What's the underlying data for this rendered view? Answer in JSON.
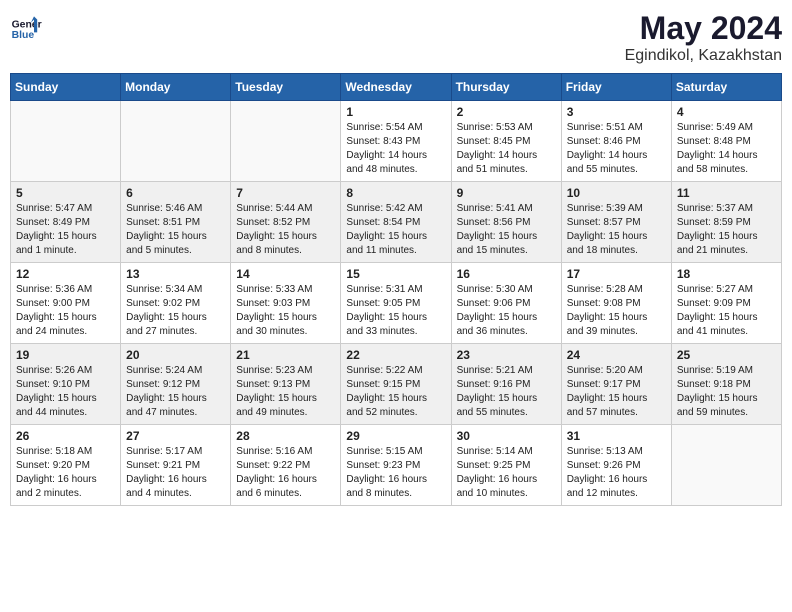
{
  "logo": {
    "line1": "General",
    "line2": "Blue"
  },
  "title": "May 2024",
  "location": "Egindikol, Kazakhstan",
  "days_of_week": [
    "Sunday",
    "Monday",
    "Tuesday",
    "Wednesday",
    "Thursday",
    "Friday",
    "Saturday"
  ],
  "weeks": [
    [
      {
        "day": "",
        "info": ""
      },
      {
        "day": "",
        "info": ""
      },
      {
        "day": "",
        "info": ""
      },
      {
        "day": "1",
        "info": "Sunrise: 5:54 AM\nSunset: 8:43 PM\nDaylight: 14 hours\nand 48 minutes."
      },
      {
        "day": "2",
        "info": "Sunrise: 5:53 AM\nSunset: 8:45 PM\nDaylight: 14 hours\nand 51 minutes."
      },
      {
        "day": "3",
        "info": "Sunrise: 5:51 AM\nSunset: 8:46 PM\nDaylight: 14 hours\nand 55 minutes."
      },
      {
        "day": "4",
        "info": "Sunrise: 5:49 AM\nSunset: 8:48 PM\nDaylight: 14 hours\nand 58 minutes."
      }
    ],
    [
      {
        "day": "5",
        "info": "Sunrise: 5:47 AM\nSunset: 8:49 PM\nDaylight: 15 hours\nand 1 minute."
      },
      {
        "day": "6",
        "info": "Sunrise: 5:46 AM\nSunset: 8:51 PM\nDaylight: 15 hours\nand 5 minutes."
      },
      {
        "day": "7",
        "info": "Sunrise: 5:44 AM\nSunset: 8:52 PM\nDaylight: 15 hours\nand 8 minutes."
      },
      {
        "day": "8",
        "info": "Sunrise: 5:42 AM\nSunset: 8:54 PM\nDaylight: 15 hours\nand 11 minutes."
      },
      {
        "day": "9",
        "info": "Sunrise: 5:41 AM\nSunset: 8:56 PM\nDaylight: 15 hours\nand 15 minutes."
      },
      {
        "day": "10",
        "info": "Sunrise: 5:39 AM\nSunset: 8:57 PM\nDaylight: 15 hours\nand 18 minutes."
      },
      {
        "day": "11",
        "info": "Sunrise: 5:37 AM\nSunset: 8:59 PM\nDaylight: 15 hours\nand 21 minutes."
      }
    ],
    [
      {
        "day": "12",
        "info": "Sunrise: 5:36 AM\nSunset: 9:00 PM\nDaylight: 15 hours\nand 24 minutes."
      },
      {
        "day": "13",
        "info": "Sunrise: 5:34 AM\nSunset: 9:02 PM\nDaylight: 15 hours\nand 27 minutes."
      },
      {
        "day": "14",
        "info": "Sunrise: 5:33 AM\nSunset: 9:03 PM\nDaylight: 15 hours\nand 30 minutes."
      },
      {
        "day": "15",
        "info": "Sunrise: 5:31 AM\nSunset: 9:05 PM\nDaylight: 15 hours\nand 33 minutes."
      },
      {
        "day": "16",
        "info": "Sunrise: 5:30 AM\nSunset: 9:06 PM\nDaylight: 15 hours\nand 36 minutes."
      },
      {
        "day": "17",
        "info": "Sunrise: 5:28 AM\nSunset: 9:08 PM\nDaylight: 15 hours\nand 39 minutes."
      },
      {
        "day": "18",
        "info": "Sunrise: 5:27 AM\nSunset: 9:09 PM\nDaylight: 15 hours\nand 41 minutes."
      }
    ],
    [
      {
        "day": "19",
        "info": "Sunrise: 5:26 AM\nSunset: 9:10 PM\nDaylight: 15 hours\nand 44 minutes."
      },
      {
        "day": "20",
        "info": "Sunrise: 5:24 AM\nSunset: 9:12 PM\nDaylight: 15 hours\nand 47 minutes."
      },
      {
        "day": "21",
        "info": "Sunrise: 5:23 AM\nSunset: 9:13 PM\nDaylight: 15 hours\nand 49 minutes."
      },
      {
        "day": "22",
        "info": "Sunrise: 5:22 AM\nSunset: 9:15 PM\nDaylight: 15 hours\nand 52 minutes."
      },
      {
        "day": "23",
        "info": "Sunrise: 5:21 AM\nSunset: 9:16 PM\nDaylight: 15 hours\nand 55 minutes."
      },
      {
        "day": "24",
        "info": "Sunrise: 5:20 AM\nSunset: 9:17 PM\nDaylight: 15 hours\nand 57 minutes."
      },
      {
        "day": "25",
        "info": "Sunrise: 5:19 AM\nSunset: 9:18 PM\nDaylight: 15 hours\nand 59 minutes."
      }
    ],
    [
      {
        "day": "26",
        "info": "Sunrise: 5:18 AM\nSunset: 9:20 PM\nDaylight: 16 hours\nand 2 minutes."
      },
      {
        "day": "27",
        "info": "Sunrise: 5:17 AM\nSunset: 9:21 PM\nDaylight: 16 hours\nand 4 minutes."
      },
      {
        "day": "28",
        "info": "Sunrise: 5:16 AM\nSunset: 9:22 PM\nDaylight: 16 hours\nand 6 minutes."
      },
      {
        "day": "29",
        "info": "Sunrise: 5:15 AM\nSunset: 9:23 PM\nDaylight: 16 hours\nand 8 minutes."
      },
      {
        "day": "30",
        "info": "Sunrise: 5:14 AM\nSunset: 9:25 PM\nDaylight: 16 hours\nand 10 minutes."
      },
      {
        "day": "31",
        "info": "Sunrise: 5:13 AM\nSunset: 9:26 PM\nDaylight: 16 hours\nand 12 minutes."
      },
      {
        "day": "",
        "info": ""
      }
    ]
  ]
}
